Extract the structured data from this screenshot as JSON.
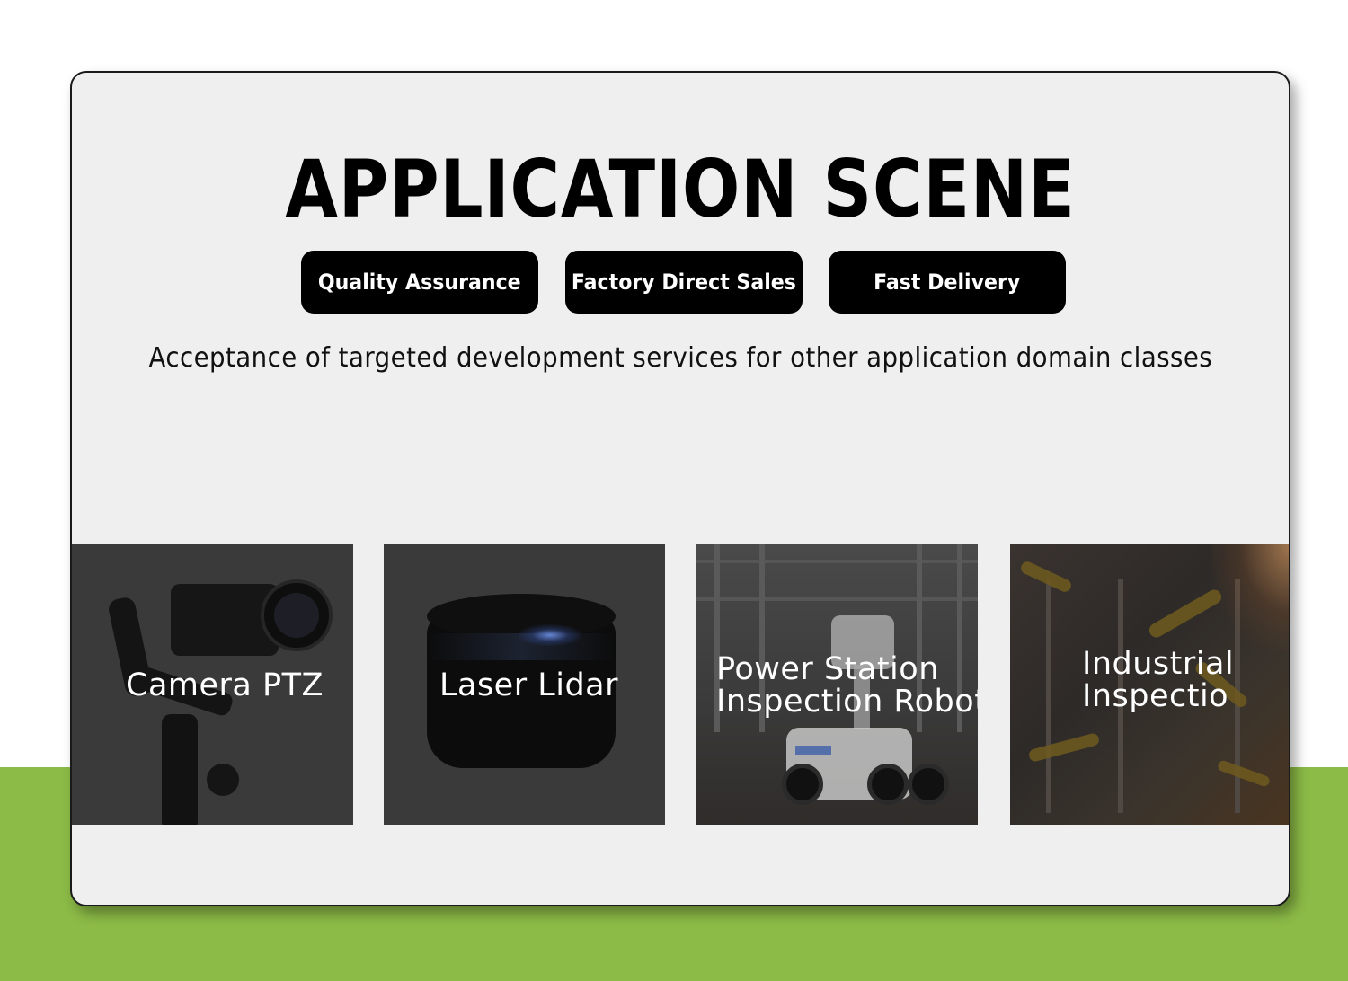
{
  "title": "APPLICATION SCENE",
  "badges": [
    {
      "label": "Quality Assurance"
    },
    {
      "label": "Factory Direct Sales"
    },
    {
      "label": "Fast Delivery"
    }
  ],
  "subtitle": "Acceptance of targeted development services for other application domain classes",
  "tiles": [
    {
      "label": "Camera PTZ",
      "image": "camera-gimbal-photo"
    },
    {
      "label": "Laser Lidar",
      "image": "lidar-sensor-photo"
    },
    {
      "label_line1": "Power Station",
      "label_line2": "Inspection Robot",
      "image": "inspection-robot-photo"
    },
    {
      "label_line1": "Industrial",
      "label_line2": "Inspectio",
      "image": "industrial-robot-arms-photo"
    }
  ],
  "colors": {
    "accent_green": "#8cbb47",
    "card_background": "#efefef",
    "badge_background": "#000000",
    "tile_overlay": "#3a3a3a"
  }
}
